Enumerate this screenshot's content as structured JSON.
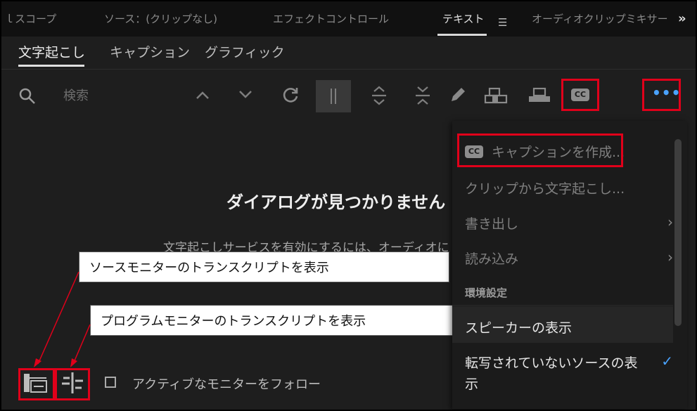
{
  "panel_tabs": [
    {
      "label": "ｌスコープ",
      "active": false
    },
    {
      "label": "ソース：(クリップなし)",
      "active": false
    },
    {
      "label": "エフェクトコントロール",
      "active": false
    },
    {
      "label": "テキスト",
      "active": true
    },
    {
      "label": "オーディオクリップミキサー",
      "active": false
    }
  ],
  "panel_menu_glyph": "☰",
  "panel_more_glyph": "»",
  "subtabs": [
    {
      "label": "文字起こし",
      "active": true
    },
    {
      "label": "キャプション",
      "active": false
    },
    {
      "label": "グラフィック",
      "active": false
    }
  ],
  "search": {
    "placeholder": "検索"
  },
  "cc_label": "CC",
  "more_dots": "•••",
  "empty_state": {
    "title": "ダイアログが見つかりません",
    "desc": "文字起こしサービスを有効にするには、オーディオに"
  },
  "callouts": {
    "source": "ソースモニターのトランスクリプトを表示",
    "program": "プログラムモニターのトランスクリプトを表示"
  },
  "follow_label": "アクティブなモニターをフォロー",
  "menu": {
    "create_captions": "キャプションを作成...",
    "transcribe_clip": "クリップから文字起こし...",
    "export": "書き出し",
    "import": "読み込み",
    "section": "環境設定",
    "show_speakers": "スピーカーの表示",
    "show_untranscribed": "転写されていないソースの表\n示",
    "show_untranscribed_line1": "転写されていないソースの表",
    "show_untranscribed_line2": "示",
    "chevron": "›",
    "check": "✓"
  },
  "colors": {
    "highlight": "#e0001a",
    "accent_blue": "#4aa3ff"
  }
}
